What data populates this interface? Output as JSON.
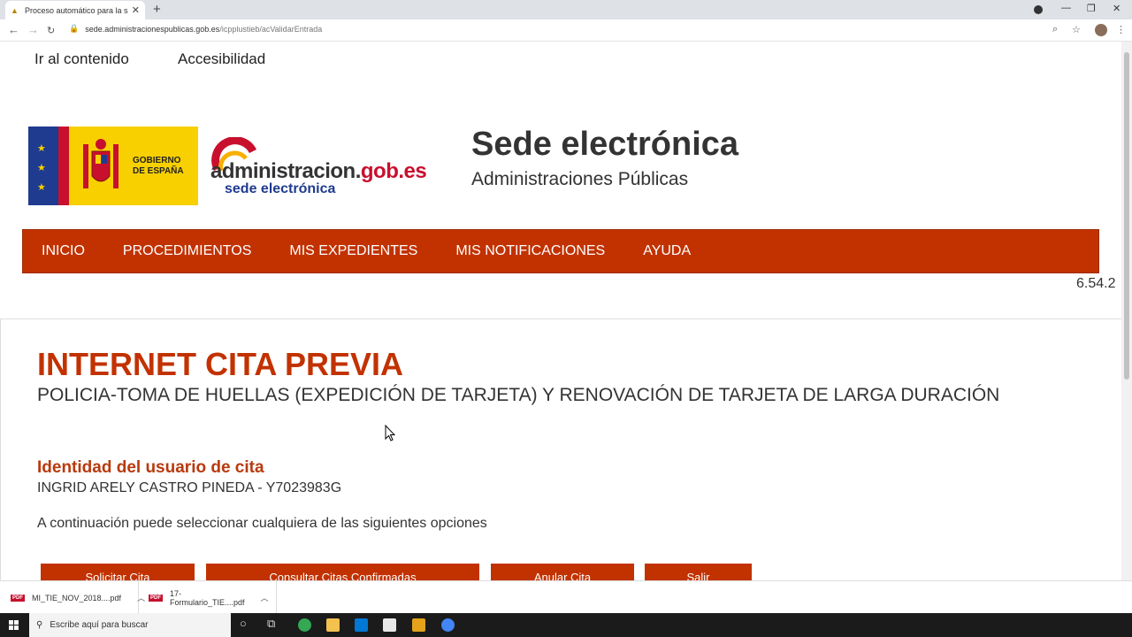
{
  "browser": {
    "tab_title": "Proceso automático para la solicitud",
    "new_tab": "+",
    "url_domain": "sede.administracionespublicas.gob.es",
    "url_path": "/icpplustieb/acValidarEntrada"
  },
  "skip_links": [
    "Ir al contenido",
    "Accesibilidad"
  ],
  "header": {
    "gov_label_1": "GOBIERNO",
    "gov_label_2": "DE ESPAÑA",
    "brand_main": "administracion.",
    "brand_gob": "gob.es",
    "brand_sub": "sede electrónica",
    "site_title": "Sede electrónica",
    "site_subtitle": "Administraciones Públicas"
  },
  "nav": [
    "INICIO",
    "PROCEDIMIENTOS",
    "MIS EXPEDIENTES",
    "MIS NOTIFICACIONES",
    "AYUDA"
  ],
  "version": "6.54.2",
  "content": {
    "title": "INTERNET CITA PREVIA",
    "subtitle": "POLICIA-TOMA DE HUELLAS (EXPEDICIÓN DE TARJETA) Y RENOVACIÓN DE TARJETA DE LARGA DURACIÓN",
    "identity_heading": "Identidad del usuario de cita",
    "identity_value": "INGRID ARELY CASTRO PINEDA - Y7023983G",
    "options_hint": "A continuación puede seleccionar cualquiera de las siguientes opciones",
    "buttons": [
      "Solicitar Cita",
      "Consultar Citas Confirmadas",
      "Anular Cita",
      "Salir"
    ]
  },
  "downloads": [
    {
      "name": "MI_TIE_NOV_2018....pdf",
      "badge": "PDF"
    },
    {
      "name": "17-Formulario_TIE....pdf",
      "badge": "PDF"
    }
  ],
  "taskbar": {
    "search_placeholder": "Escribe aquí para buscar"
  },
  "colors": {
    "accent": "#c23200",
    "heading": "#b83a0e"
  }
}
